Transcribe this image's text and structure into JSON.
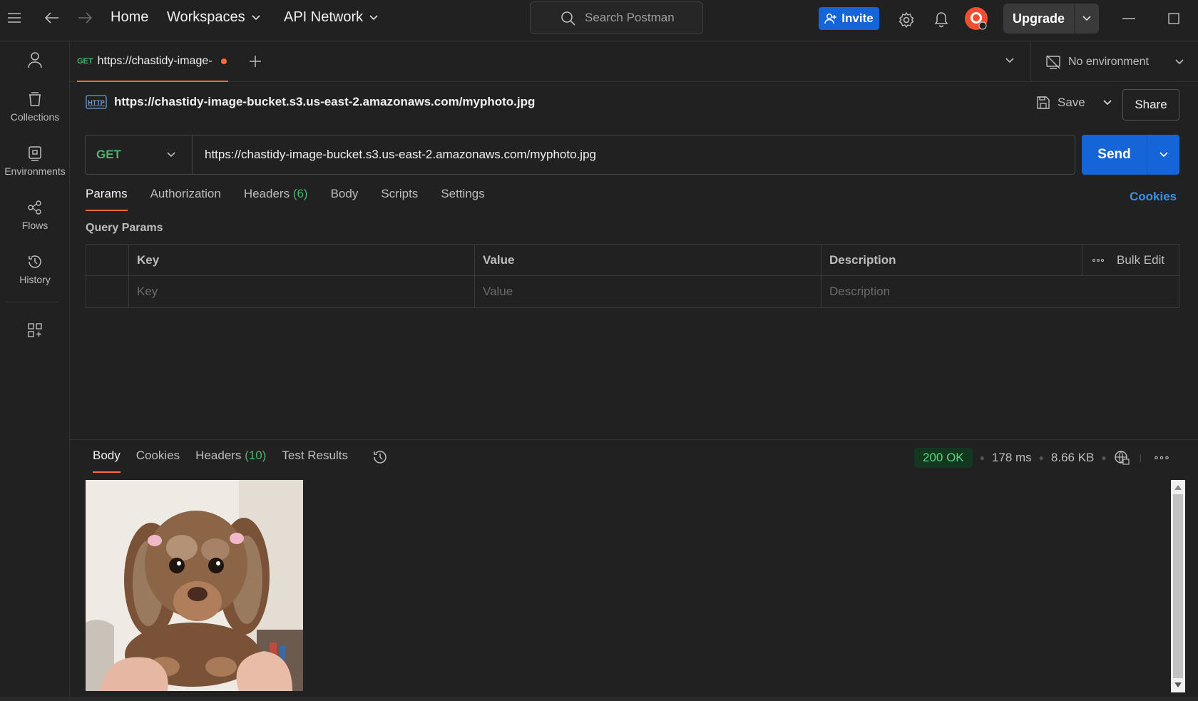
{
  "topbar": {
    "nav": {
      "home": "Home",
      "workspaces": "Workspaces",
      "api_network": "API Network"
    },
    "search_placeholder": "Search Postman",
    "invite_label": "Invite",
    "upgrade_label": "Upgrade"
  },
  "sidebar": {
    "items": [
      {
        "label": "Collections",
        "icon": "collections-icon"
      },
      {
        "label": "Environments",
        "icon": "environments-icon"
      },
      {
        "label": "Flows",
        "icon": "flows-icon"
      },
      {
        "label": "History",
        "icon": "history-icon"
      }
    ]
  },
  "tabs": {
    "request_tab": {
      "method": "GET",
      "title": "https://chastidy-image-"
    },
    "environment": "No environment"
  },
  "request": {
    "title": "https://chastidy-image-bucket.s3.us-east-2.amazonaws.com/myphoto.jpg",
    "save_label": "Save",
    "share_label": "Share",
    "method": "GET",
    "url": "https://chastidy-image-bucket.s3.us-east-2.amazonaws.com/myphoto.jpg",
    "send_label": "Send",
    "tabs": {
      "params": "Params",
      "authorization": "Authorization",
      "headers": "Headers",
      "headers_count": "(6)",
      "body": "Body",
      "scripts": "Scripts",
      "settings": "Settings"
    },
    "cookies_link": "Cookies",
    "query_params_title": "Query Params",
    "table": {
      "headers": {
        "key": "Key",
        "value": "Value",
        "description": "Description",
        "bulk_edit": "Bulk Edit"
      },
      "placeholders": {
        "key": "Key",
        "value": "Value",
        "description": "Description"
      }
    }
  },
  "response": {
    "tabs": {
      "body": "Body",
      "cookies": "Cookies",
      "headers": "Headers",
      "headers_count": "(10)",
      "test_results": "Test Results"
    },
    "status": "200 OK",
    "time": "178 ms",
    "size": "8.66 KB"
  },
  "colors": {
    "accent_orange": "#ff6c37",
    "brand_blue": "#1565d8",
    "method_green": "#4bb36b",
    "link_blue": "#3b8fe6"
  }
}
